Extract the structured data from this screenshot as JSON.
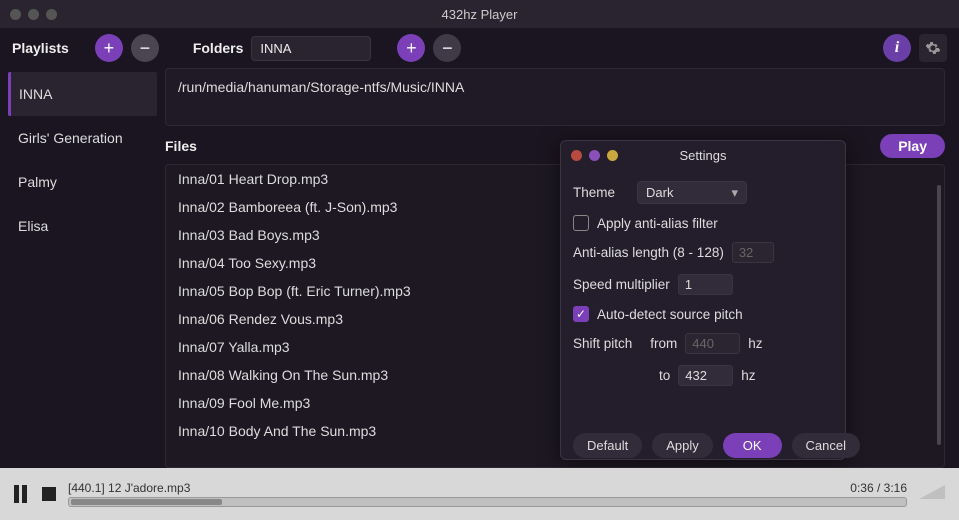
{
  "window": {
    "title": "432hz Player"
  },
  "toolbar": {
    "playlists_label": "Playlists",
    "folders_label": "Folders",
    "folder_value": "INNA"
  },
  "playlists": [
    {
      "name": "INNA",
      "active": true
    },
    {
      "name": "Girls' Generation",
      "active": false
    },
    {
      "name": "Palmy",
      "active": false
    },
    {
      "name": "Elisa",
      "active": false
    }
  ],
  "folder_path": "/run/media/hanuman/Storage-ntfs/Music/INNA",
  "files_label": "Files",
  "play_label": "Play",
  "files": [
    "Inna/01 Heart Drop.mp3",
    "Inna/02 Bamboreea (ft. J-Son).mp3",
    "Inna/03 Bad Boys.mp3",
    "Inna/04 Too Sexy.mp3",
    "Inna/05 Bop Bop (ft. Eric Turner).mp3",
    "Inna/06 Rendez Vous.mp3",
    "Inna/07 Yalla.mp3",
    "Inna/08 Walking On The Sun.mp3",
    "Inna/09 Fool Me.mp3",
    "Inna/10 Body And The Sun.mp3"
  ],
  "settings": {
    "title": "Settings",
    "theme_label": "Theme",
    "theme_value": "Dark",
    "anti_alias_label": "Apply anti-alias filter",
    "anti_alias_checked": false,
    "anti_alias_length_label": "Anti-alias length (8 - 128)",
    "anti_alias_length_value": "32",
    "speed_label": "Speed multiplier",
    "speed_value": "1",
    "auto_detect_label": "Auto-detect source pitch",
    "auto_detect_checked": true,
    "shift_pitch_label": "Shift pitch",
    "from_label": "from",
    "from_value": "440",
    "to_label": "to",
    "to_value": "432",
    "hz_label": "hz",
    "default_label": "Default",
    "apply_label": "Apply",
    "ok_label": "OK",
    "cancel_label": "Cancel"
  },
  "player": {
    "now_playing": "[440.1] 12 J'adore.mp3",
    "elapsed": "0:36",
    "total": "3:16"
  }
}
